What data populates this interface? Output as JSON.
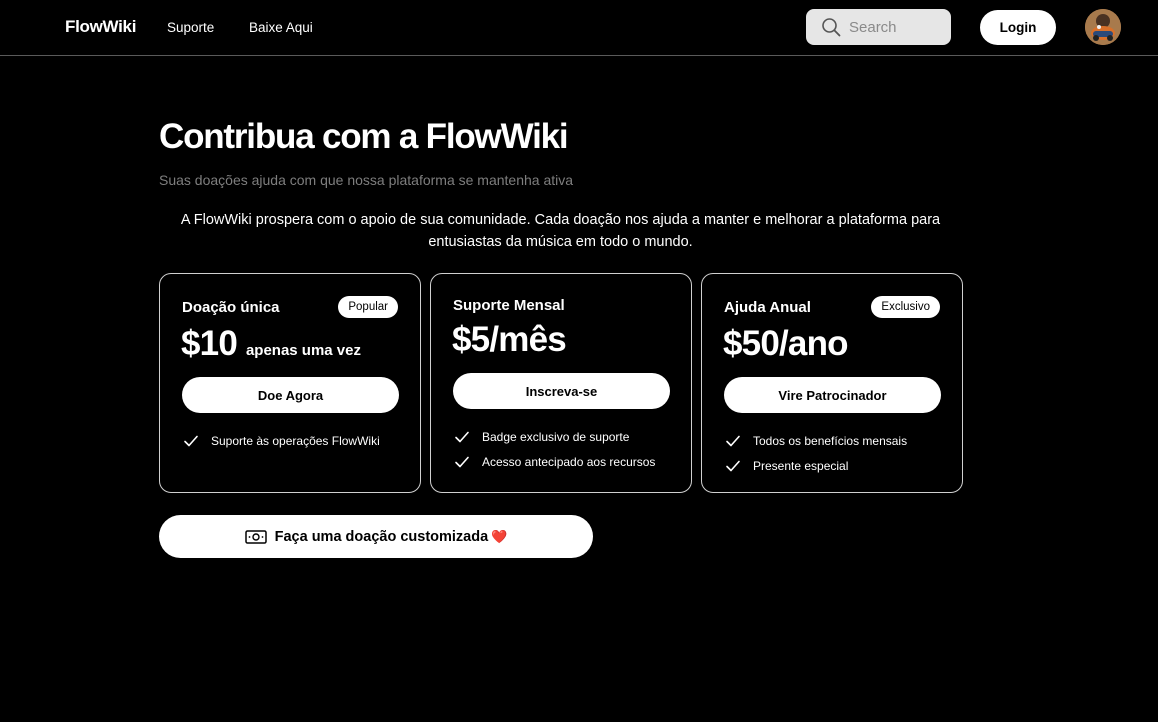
{
  "header": {
    "brand": "FlowWiki",
    "nav": [
      {
        "label": "Suporte"
      },
      {
        "label": "Baixe Aqui"
      }
    ],
    "search_placeholder": "Search",
    "login_label": "Login"
  },
  "hero": {
    "title": "Contribua com a FlowWiki",
    "subtitle": "Suas doações ajuda com que nossa plataforma se mantenha ativa",
    "intro": "A FlowWiki prospera com o apoio de sua comunidade. Cada doação nos ajuda a manter e melhorar a plataforma para entusiastas da música em todo o mundo."
  },
  "plans": [
    {
      "title": "Doação única",
      "badge": "Popular",
      "price": "$10",
      "price_note": "apenas uma vez",
      "cta": "Doe Agora",
      "features": [
        "Suporte às operações FlowWiki"
      ]
    },
    {
      "title": "Suporte Mensal",
      "price": "$5/mês",
      "cta": "Inscreva-se",
      "features": [
        "Badge exclusivo de suporte",
        "Acesso antecipado aos recursos"
      ]
    },
    {
      "title": "Ajuda Anual",
      "badge": "Exclusivo",
      "price": "$50/ano",
      "cta": "Vire Patrocinador",
      "features": [
        "Todos os benefícios mensais",
        "Presente especial"
      ]
    }
  ],
  "custom_donation": {
    "label": "Faça uma doação customizada",
    "emoji": "❤️"
  },
  "icons": {
    "search": "search-icon",
    "check": "check-icon",
    "money": "money-icon"
  }
}
